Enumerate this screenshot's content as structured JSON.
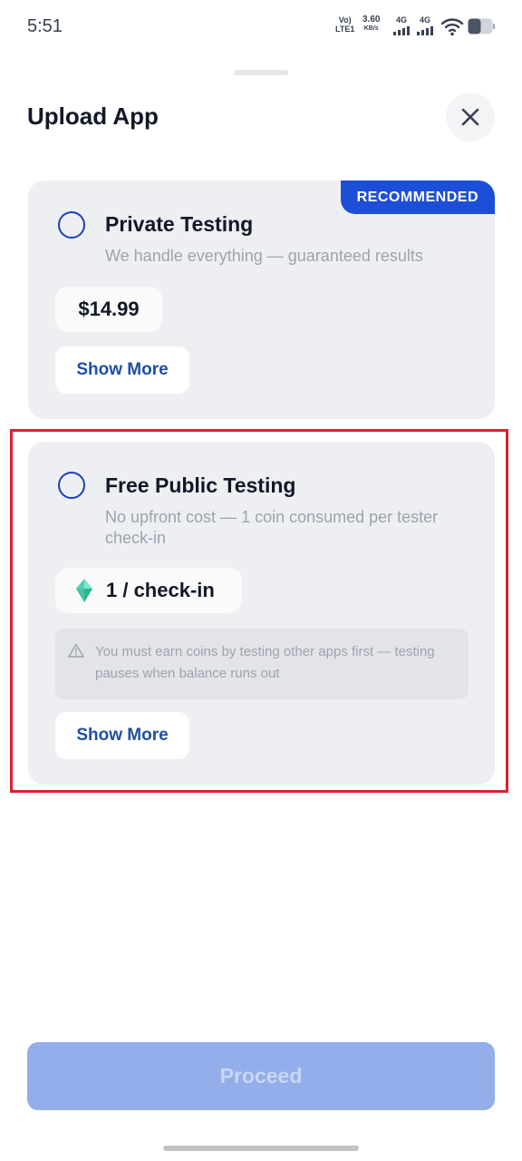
{
  "status_bar": {
    "time": "5:51",
    "volte_top": "Vo)",
    "volte_bottom": "LTE1",
    "speed_value": "3.60",
    "speed_unit": "KB/s",
    "network1": "4G",
    "network2": "4G",
    "icons": [
      "signal-bars-icon",
      "wifi-icon",
      "battery-icon"
    ]
  },
  "sheet": {
    "title": "Upload App",
    "close_icon": "close-icon"
  },
  "options": [
    {
      "title": "Private Testing",
      "description": "We handle everything — guaranteed results",
      "price": "$14.99",
      "badge": "RECOMMENDED",
      "show_more": "Show More",
      "selected": false
    },
    {
      "title": "Free Public Testing",
      "description": "No upfront cost — 1 coin consumed per tester check-in",
      "cost": "1 / check-in",
      "cost_icon": "gem-icon",
      "warning": "You must earn coins by testing other apps first — testing pauses when balance runs out",
      "warning_icon": "warning-icon",
      "show_more": "Show More",
      "selected": false
    }
  ],
  "footer": {
    "proceed_label": "Proceed",
    "proceed_enabled": false
  },
  "colors": {
    "accent": "#1d4ed8",
    "card_background": "#eeeff2",
    "highlight_border": "#e11d2e",
    "proceed_disabled": "#93aeea"
  }
}
